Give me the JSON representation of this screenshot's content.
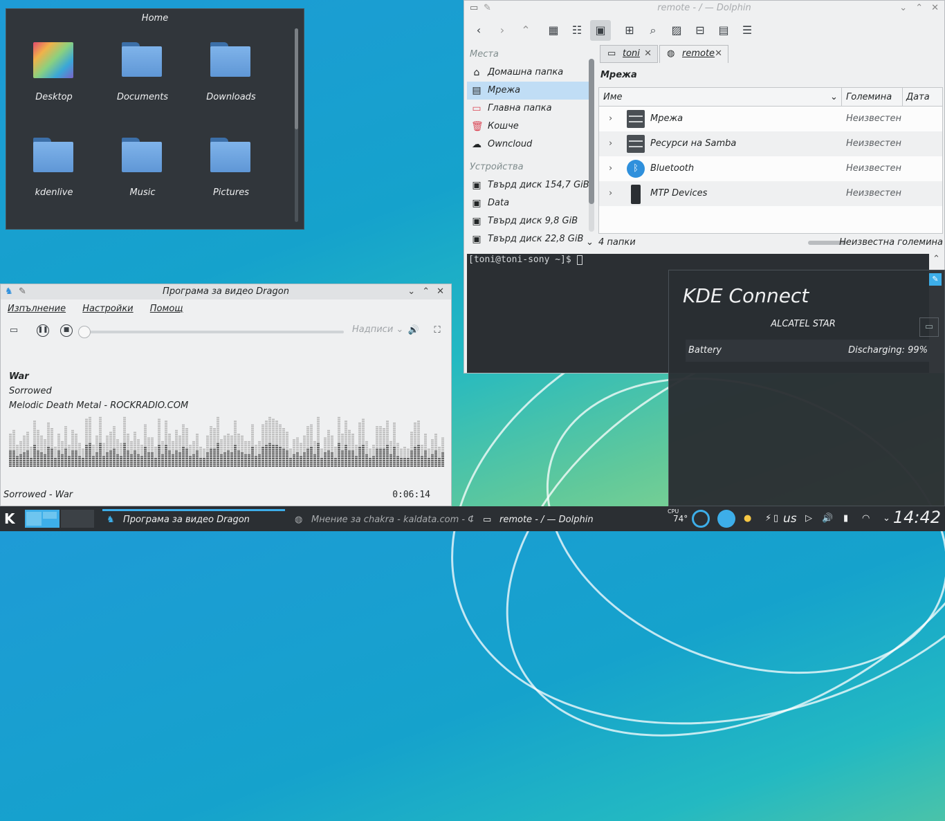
{
  "home": {
    "title": "Home",
    "items": [
      {
        "label": "Desktop",
        "type": "desktop"
      },
      {
        "label": "Documents",
        "type": "folder"
      },
      {
        "label": "Downloads",
        "type": "folder"
      },
      {
        "label": "kdenlive",
        "type": "folder"
      },
      {
        "label": "Music",
        "type": "folder"
      },
      {
        "label": "Pictures",
        "type": "folder"
      }
    ]
  },
  "dolphin": {
    "title": "remote - / — Dolphin",
    "places_header": "Места",
    "places": [
      {
        "label": "Домашна папка",
        "icon": "home-icon"
      },
      {
        "label": "Мрежа",
        "icon": "network-icon"
      },
      {
        "label": "Главна папка",
        "icon": "root-folder-icon"
      },
      {
        "label": "Кошче",
        "icon": "trash-icon"
      },
      {
        "label": "Owncloud",
        "icon": "cloud-icon"
      }
    ],
    "devices_header": "Устройства",
    "devices": [
      {
        "label": "Твърд диск 154,7 GiB"
      },
      {
        "label": "Data"
      },
      {
        "label": "Твърд диск 9,8 GiB"
      },
      {
        "label": "Твърд диск 22,8 GiB"
      }
    ],
    "tabs": [
      {
        "label": "toni"
      },
      {
        "label": "remote"
      }
    ],
    "location": "Мрежа",
    "columns": {
      "name": "Име",
      "size": "Големина",
      "date": "Дата"
    },
    "rows": [
      {
        "name": "Мрежа",
        "size": "Неизвестен",
        "icon": "server-icon"
      },
      {
        "name": "Ресурси на Samba",
        "size": "Неизвестен",
        "icon": "server-icon"
      },
      {
        "name": "Bluetooth",
        "size": "Неизвестен",
        "icon": "bluetooth-icon"
      },
      {
        "name": "MTP Devices",
        "size": "Неизвестен",
        "icon": "phone-icon"
      }
    ],
    "status_count": "4 папки",
    "status_size": "Неизвестна големина",
    "terminal_prompt": "[toni@toni-sony ~]$ "
  },
  "dragon": {
    "title": "Програма за видео Dragon",
    "menu": [
      "Изпълнение",
      "Настройки",
      "Помощ"
    ],
    "subtitles": "Надписи",
    "track_title": "War",
    "track_artist": "Sorrowed",
    "track_station": "Melodic Death Metal - ROCKRADIO.COM",
    "footer": "Sorrowed - War",
    "time": "0:06:14",
    "progress": 0.0
  },
  "kdeconnect": {
    "title": "KDE Connect",
    "device": "ALCATEL STAR",
    "battery_label": "Battery",
    "battery_value": "Discharging: 99%"
  },
  "taskbar": {
    "tasks": [
      {
        "label": "Програма за видео Dragon"
      },
      {
        "label": "Мнение за chakra - kaldata.com - Фор"
      },
      {
        "label": "remote - / — Dolphin"
      }
    ],
    "cpu_label": "CPU",
    "temperature": "74°",
    "keyboard_layout": "us",
    "clock": "14:42"
  }
}
